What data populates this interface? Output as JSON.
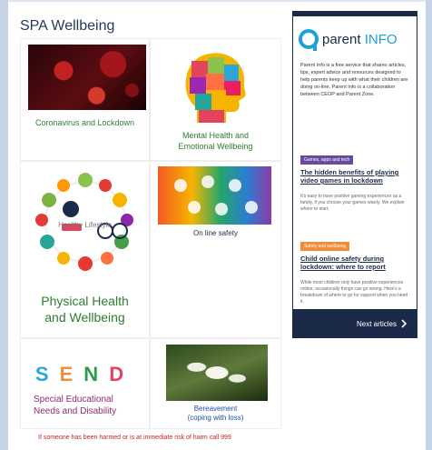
{
  "page": {
    "title": "SPA Wellbeing",
    "footer_note": "If someone has been harmed or is at immediate risk of harm call 999"
  },
  "tiles": [
    {
      "id": "coronavirus",
      "label": "Coronavirus and Lockdown",
      "color": "#2e7d32"
    },
    {
      "id": "mental-health",
      "label_line1": "Mental Health and",
      "label_line2": "Emotional Wellbeing",
      "color": "#2e7d32"
    },
    {
      "id": "physical-health",
      "banner": "Healthy Lifestyle",
      "label_line1": "Physical Health",
      "label_line2": "and Wellbeing",
      "color": "#2e7d32"
    },
    {
      "id": "online",
      "label": "On line safety",
      "color": "#1c2a4a"
    },
    {
      "id": "send",
      "letters": [
        "S",
        "E",
        "N",
        "D"
      ],
      "letter_colors": [
        "#2aa6d8",
        "#f28c38",
        "#2e9b4a",
        "#e2445c"
      ],
      "label_line1": "Special Educational",
      "label_line2": "Needs and Disability",
      "color": "#8e2a6e"
    },
    {
      "id": "bereavement",
      "label_line1": "Bereavement",
      "label_line2": "(coping with loss)",
      "color": "#1f4fa3"
    }
  ],
  "parent_info": {
    "logo_left": "parent",
    "logo_right": "INFO",
    "intro": "Parent Info is a free service that shares articles, tips, expert advice and resources designed to help parents keep up with what their children are doing on-line. Parent Info is a collaboration between CEOP and Parent Zone.",
    "articles": [
      {
        "tag": "Games, apps and tech",
        "headline": "The hidden benefits of playing video games in lockdown",
        "summary": "It's easy to have positive gaming experiences as a family, if you choose your games wisely. We explain where to start."
      },
      {
        "tag": "Safety and wellbeing",
        "headline": "Child online safety during lockdown: where to report",
        "summary": "While most children only have positive experiences online, occasionally things can go wrong. Here's a breakdown of where to go for support when you need it."
      }
    ],
    "next_label": "Next articles",
    "next_icon": "chevron-right-icon"
  },
  "colors": {
    "navy": "#1c2a4a",
    "accent_blue": "#1ea0d8",
    "alert_red": "#cc1f1f"
  }
}
